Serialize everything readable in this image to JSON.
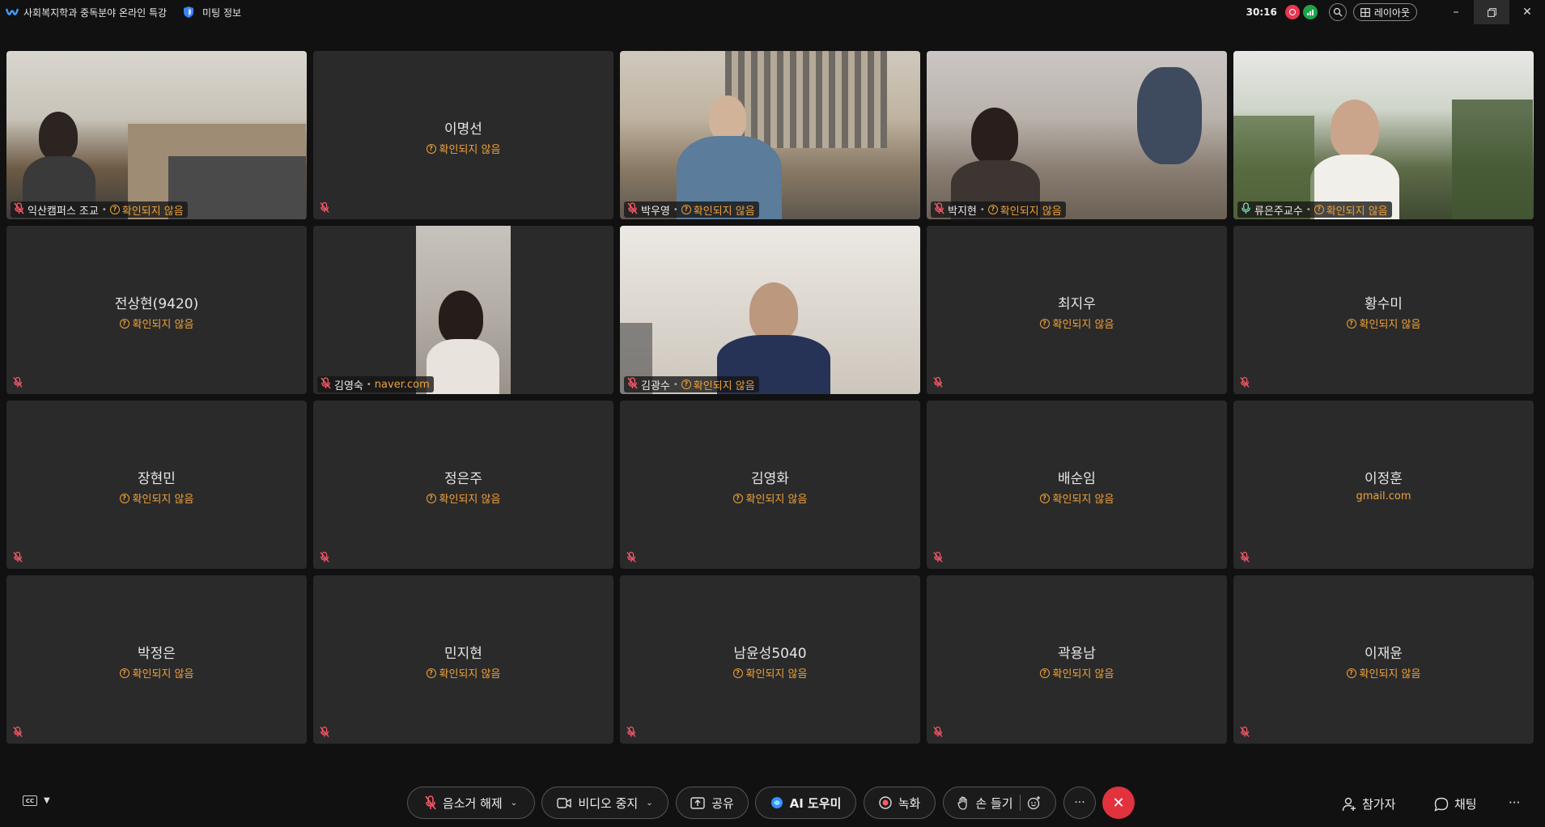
{
  "titlebar": {
    "title": "사회복지학과 중독분야 온라인 특강",
    "meeting_info": "미팅 정보",
    "timer": "30:16",
    "layout_label": "레이아웃"
  },
  "colors": {
    "accent_speaker": "#1fb5a5",
    "unverified": "#f0a23a",
    "end_call": "#e2323d",
    "recording": "#e8384f",
    "signal": "#1ea34a"
  },
  "participants": [
    {
      "name": "익산캠퍼스 조교",
      "status": "확인되지 않음",
      "video": true
    },
    {
      "name": "이명선",
      "status": "확인되지 않음",
      "video": false
    },
    {
      "name": "박우영",
      "status": "확인되지 않음",
      "video": true
    },
    {
      "name": "박지현",
      "status": "확인되지 않음",
      "video": true
    },
    {
      "name": "류은주교수",
      "status": "확인되지 않음",
      "video": true,
      "speaking": true
    },
    {
      "name": "전상현(9420)",
      "status": "확인되지 않음",
      "video": false
    },
    {
      "name": "김영숙",
      "status": "naver.com",
      "video": true
    },
    {
      "name": "김광수",
      "status": "확인되지 않음",
      "video": true
    },
    {
      "name": "최지우",
      "status": "확인되지 않음",
      "video": false
    },
    {
      "name": "황수미",
      "status": "확인되지 않음",
      "video": false
    },
    {
      "name": "장현민",
      "status": "확인되지 않음",
      "video": false
    },
    {
      "name": "정은주",
      "status": "확인되지 않음",
      "video": false
    },
    {
      "name": "김영화",
      "status": "확인되지 않음",
      "video": false
    },
    {
      "name": "배순임",
      "status": "확인되지 않음",
      "video": false
    },
    {
      "name": "이정훈",
      "status": "gmail.com",
      "video": false
    },
    {
      "name": "박정은",
      "status": "확인되지 않음",
      "video": false
    },
    {
      "name": "민지현",
      "status": "확인되지 않음",
      "video": false
    },
    {
      "name": "남윤성5040",
      "status": "확인되지 않음",
      "video": false
    },
    {
      "name": "곽용남",
      "status": "확인되지 않음",
      "video": false
    },
    {
      "name": "이재윤",
      "status": "확인되지 않음",
      "video": false
    }
  ],
  "toolbar": {
    "unmute_label": "음소거 해제",
    "stop_video_label": "비디오 중지",
    "share_label": "공유",
    "ai_label": "AI 도우미",
    "record_label": "녹화",
    "raise_hand_label": "손 들기",
    "more_label": "···",
    "participants_label": "참가자",
    "chat_label": "채팅",
    "more_right_label": "···"
  }
}
